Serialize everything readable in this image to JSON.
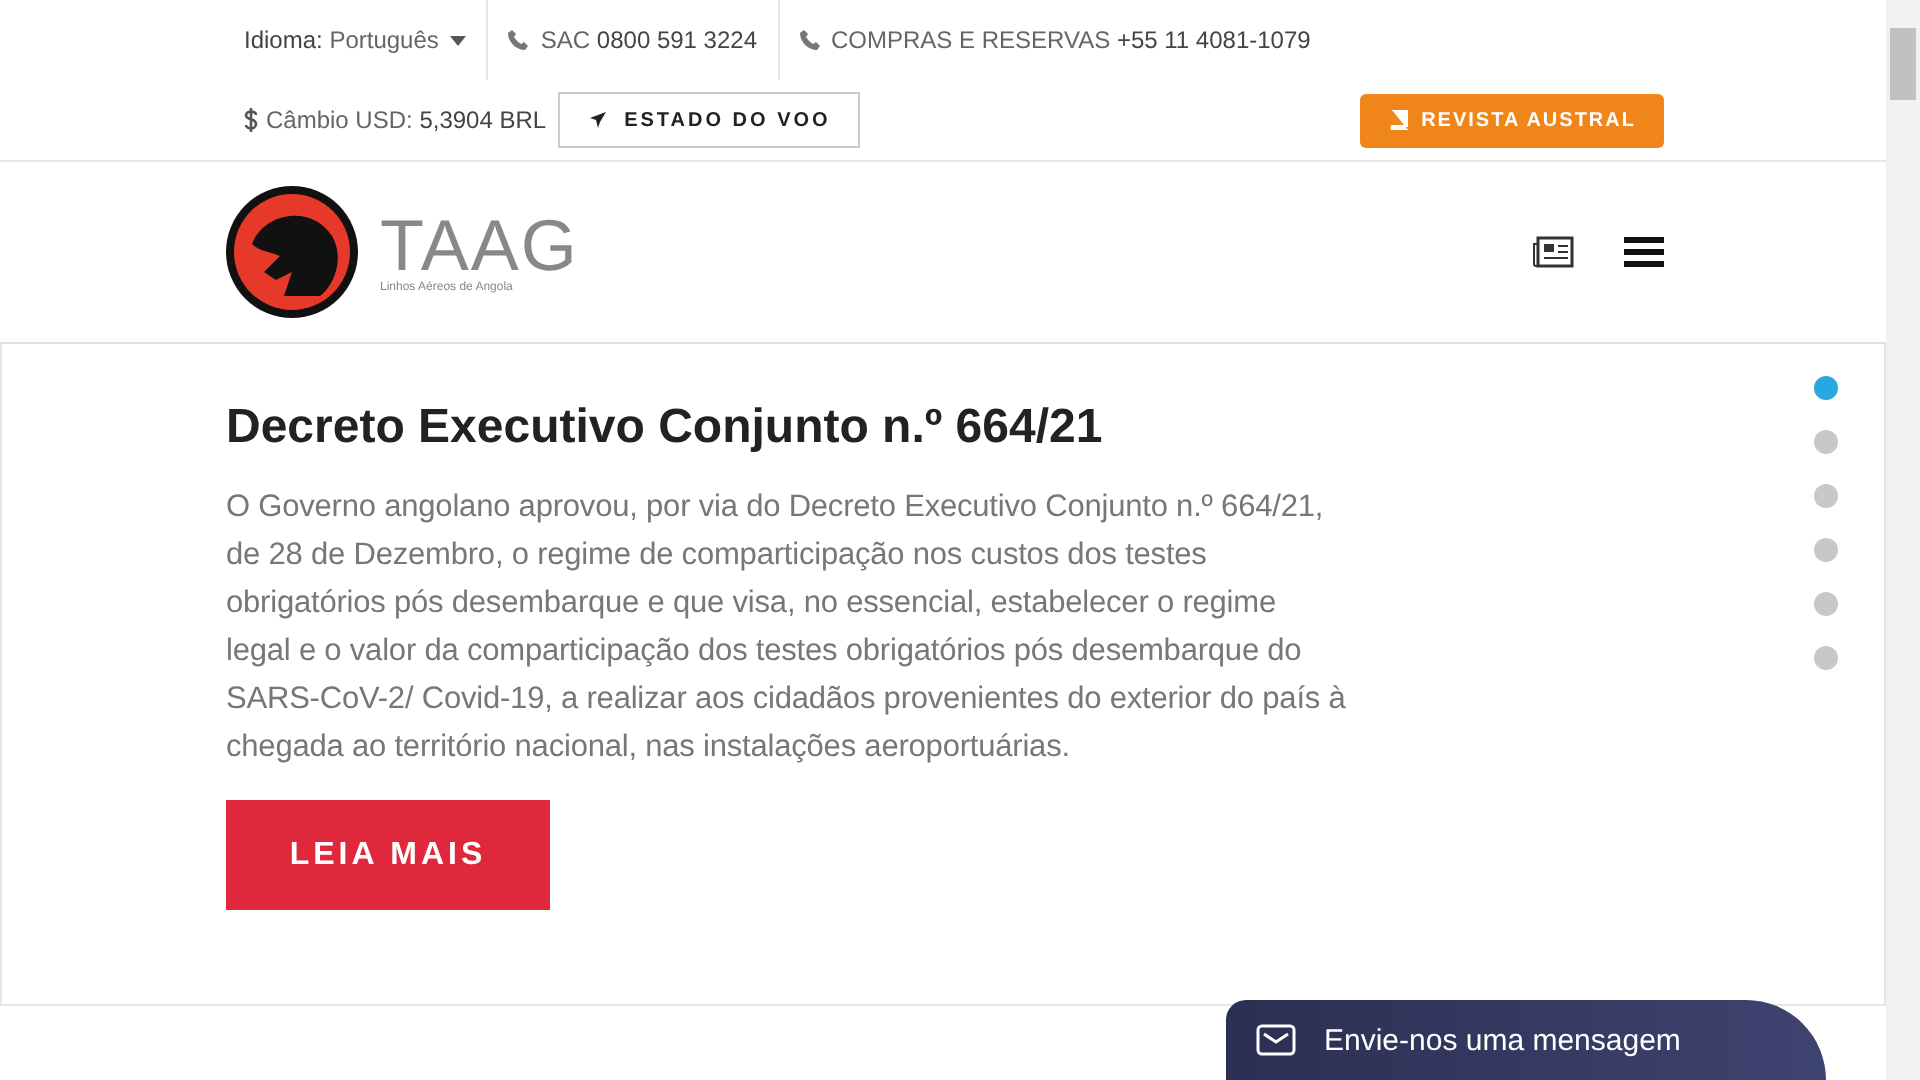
{
  "top_bar": {
    "language": "**Idioma:** Português",
    "sac": "SAC **0800 591 3224**",
    "sales": "COMPRAS E RESERVAS **+55 11 4081-1079**",
    "exchange": "Câmbio USD: **5,3904 BRL**",
    "flight_status_button": "ESTADO DO VOO",
    "magazine_button": "REVISTA AUSTRAL"
  },
  "logo": {
    "name": "TAAG",
    "tagline": "Linhos Aéreos de Angola"
  },
  "slide": {
    "title": "Decreto Executivo Conjunto n.º 664/21",
    "body": "O Governo angolano aprovou, por via do Decreto Executivo Conjunto n.º 664/21, de 28 de Dezembro, o regime de comparticipação nos custos dos testes obrigatórios pós desembarque e que visa, no essencial, estabelecer o regime legal e o valor da comparticipação dos testes obrigatórios pós desembarque do SARS-CoV-2/ Covid-19, a realizar aos cidadãos provenientes do exterior do país à chegada ao território nacional, nas instalações aeroportuárias.",
    "button": "LEIA MAIS"
  },
  "slide_dots": [
    {
      "selected": true
    },
    {
      "selected": false
    },
    {
      "selected": false
    },
    {
      "selected": false
    },
    {
      "selected": false
    },
    {
      "selected": false
    }
  ],
  "chat": {
    "label": "Envie-nos uma mensagem"
  }
}
